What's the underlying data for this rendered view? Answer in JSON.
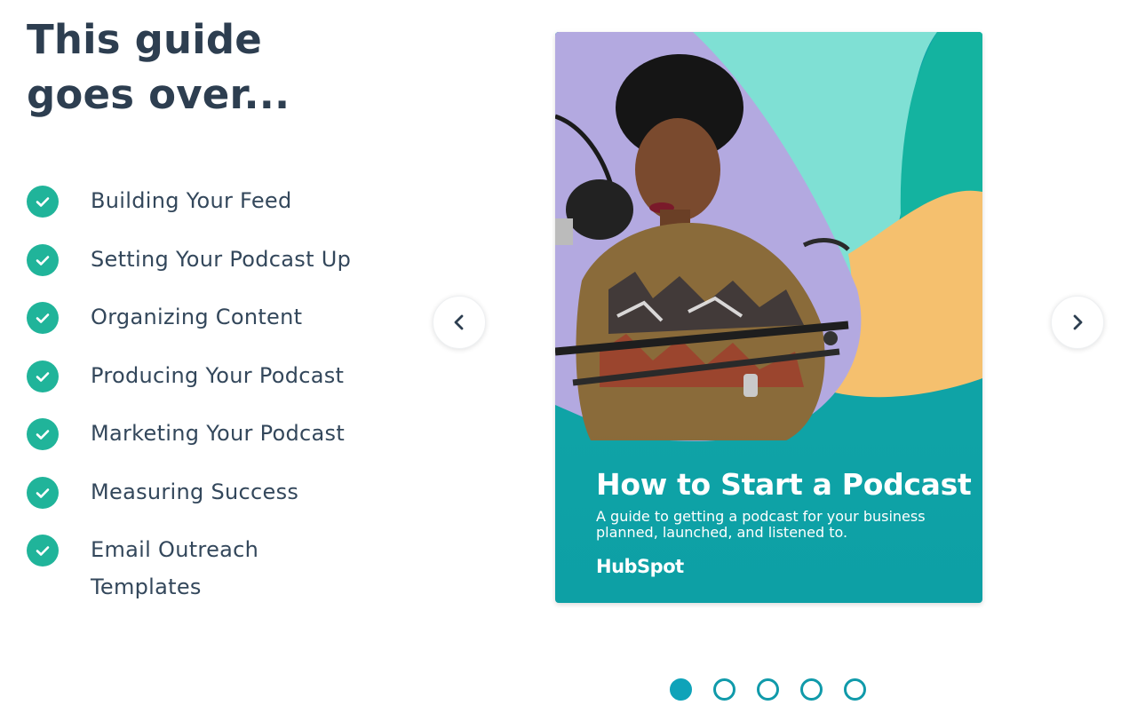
{
  "heading": "This guide goes over...",
  "checklist": {
    "items": [
      {
        "label": "Building Your Feed",
        "icon": "check-circle-icon"
      },
      {
        "label": "Setting Your Podcast Up",
        "icon": "check-circle-icon"
      },
      {
        "label": "Organizing Content",
        "icon": "check-circle-icon"
      },
      {
        "label": "Producing Your Podcast",
        "icon": "check-circle-icon"
      },
      {
        "label": "Marketing Your Podcast",
        "icon": "check-circle-icon"
      },
      {
        "label": "Measuring Success",
        "icon": "check-circle-icon"
      },
      {
        "label": "Email Outreach Templates",
        "icon": "check-circle-icon"
      }
    ]
  },
  "carousel": {
    "prev_icon": "chevron-left-icon",
    "next_icon": "chevron-right-icon",
    "slide": {
      "title": "How to Start a Podcast",
      "subtitle": "A guide to getting a podcast for your business planned, launched, and listened to.",
      "brand": "HubSpot",
      "image_alt": "Woman speaking into a studio microphone"
    },
    "total_slides": 5,
    "active_slide": 1
  },
  "colors": {
    "heading": "#2d3e50",
    "check": "#20b49a",
    "accent": "#0fa3b9",
    "cover_teal": "#0fa3a6",
    "cover_mint": "#7fe0d4",
    "cover_orange": "#f5c06e",
    "cover_lavender": "#b3a9e0"
  }
}
